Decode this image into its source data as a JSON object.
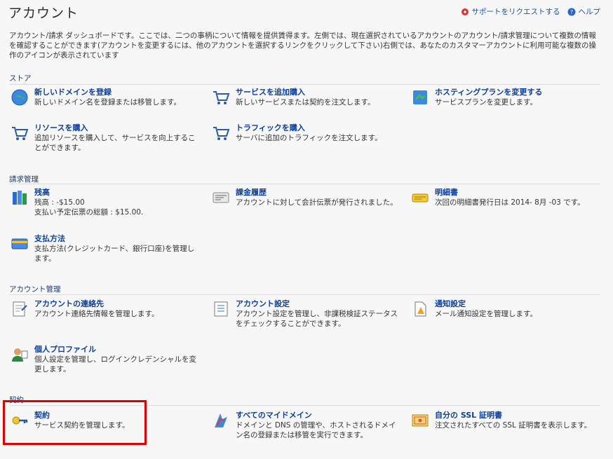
{
  "header": {
    "title": "アカウント",
    "support_link": "サポートをリクエストする",
    "help_link": "ヘルプ"
  },
  "intro_text": "アカウント/請求 ダッシュボードです。ここでは、二つの事柄について情報を提供賃得ます。左側では、現在選択されているアカウントのアカウント/請求管理について複数の情報を確認することができます(アカウントを変更するには、他のアカウントを選択するリンクをクリックして下さい)右側では、あなたのカスタマーアカウントに利用可能な複数の操作のアイコンが表示されています",
  "sections": {
    "store": {
      "label": "ストア",
      "items": [
        {
          "title": "新しいドメインを登録",
          "desc": "新しいドメイン名を登録または移管します。",
          "icon": "globe-icon"
        },
        {
          "title": "サービスを追加購入",
          "desc": "新しいサービスまたは契約を注文します。",
          "icon": "cart-icon"
        },
        {
          "title": "ホスティングプランを変更する",
          "desc": "サービスプランを変更します。",
          "icon": "hosting-icon"
        },
        {
          "title": "リソースを購入",
          "desc": "追加リソースを購入して、サービスを向上することができます。",
          "icon": "cart-icon"
        },
        {
          "title": "トラフィックを購入",
          "desc": "サーバに追加のトラフィックを注文します。",
          "icon": "cart-icon"
        }
      ]
    },
    "billing": {
      "label": "請求管理",
      "items": [
        {
          "title": "残高",
          "desc": "残高 : -$15.00\n支払い予定伝票の総額 : $15.00.",
          "icon": "balance-icon"
        },
        {
          "title": "課金履歴",
          "desc": "アカウントに対して会計伝票が発行されました。",
          "icon": "invoice-icon"
        },
        {
          "title": "明細書",
          "desc": "次回の明細書発行日は 2014- 8月 -03 です。",
          "icon": "statement-icon"
        },
        {
          "title": "支払方法",
          "desc": "支払方法(クレジットカード、銀行口座)を管理します。",
          "icon": "card-icon"
        }
      ]
    },
    "account": {
      "label": "アカウント管理",
      "items": [
        {
          "title": "アカウントの連絡先",
          "desc": "アカウント連絡先情報を管理します。",
          "icon": "contact-icon"
        },
        {
          "title": "アカウント設定",
          "desc": "アカウント設定を管理し、非課税検証ステータスをチェックすることができます。",
          "icon": "settings-icon"
        },
        {
          "title": "通知設定",
          "desc": "メール通知設定を管理します。",
          "icon": "notify-icon"
        },
        {
          "title": "個人プロファイル",
          "desc": "個人設定を管理し、ログインクレデンシャルを変更します。",
          "icon": "profile-icon"
        }
      ]
    },
    "contract": {
      "label": "契約",
      "items": [
        {
          "title": "契約",
          "desc": "サービス契約を管理します。",
          "icon": "key-icon"
        },
        {
          "title": "すべてのマイドメイン",
          "desc": "ドメインと DNS の管理や、ホストされるドメイン名の登録または移管を実行できます。",
          "icon": "domains-icon"
        },
        {
          "title": "自分の SSL 証明書",
          "desc": "注文されたすべての SSL 証明書を表示します。",
          "icon": "certificate-icon"
        }
      ]
    }
  }
}
